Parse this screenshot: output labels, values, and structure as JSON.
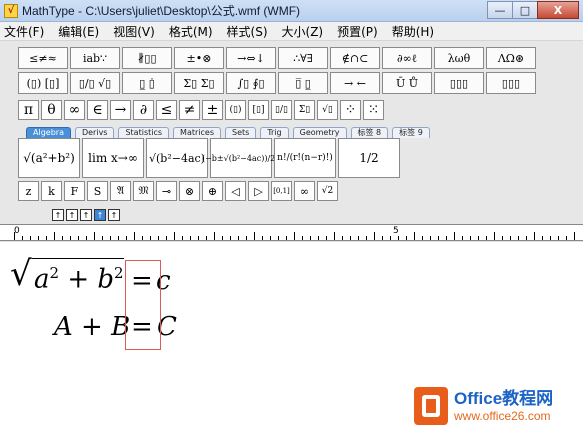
{
  "window": {
    "title": "MathType - C:\\Users\\juliet\\Desktop\\公式.wmf (WMF)",
    "app_icon_letter": "√",
    "buttons": {
      "minimize": "—",
      "maximize": "□",
      "close": "X"
    }
  },
  "menu": [
    "文件(F)",
    "编辑(E)",
    "视图(V)",
    "格式(M)",
    "样式(S)",
    "大小(Z)",
    "预置(P)",
    "帮助(H)"
  ],
  "palette_row1": [
    "≤≠≈",
    "ⅰab∵",
    "∦▯▯",
    "±•⊗",
    "→⇔↓",
    "∴∀∃",
    "∉∩⊂",
    "∂∞ℓ",
    "λωθ",
    "ΛΩ⊛"
  ],
  "palette_row2": [
    "(▯) [▯]",
    "▯/▯ √▯",
    "▯̲ ▯̇",
    "Σ▯ Σ▯",
    "∫▯ ∮▯",
    "▯̅ ▯̲",
    "→ ←",
    "Ū Ů",
    "▯▯▯",
    "▯▯▯"
  ],
  "symbol_row": [
    "π",
    "θ",
    "∞",
    "∈",
    "→",
    "∂",
    "≤",
    "≠",
    "±",
    "(▯)",
    "[▯]",
    "▯/▯",
    "Σ▯",
    "√▯",
    "⁘",
    "⁙"
  ],
  "tabs": [
    "Algebra",
    "Derivs",
    "Statistics",
    "Matrices",
    "Sets",
    "Trig",
    "Geometry",
    "标签 8",
    "标签 9"
  ],
  "active_tab": "Algebra",
  "templates": [
    "√(a²+b²)",
    "lim x→∞",
    "√(b²−4ac)",
    "(−b±√(b²−4ac))/2a",
    "n!/(r!(n−r)!)",
    "1/2"
  ],
  "small_row": [
    "z",
    "k",
    "F",
    "S",
    "𝔄",
    "𝔐",
    "⊸",
    "⊗",
    "⊕",
    "◁",
    "▷",
    "[0,1]",
    "∞",
    "√2"
  ],
  "size_buttons": [
    "↑",
    "↑",
    "↑",
    "↑",
    "↑"
  ],
  "active_size_index": 3,
  "ruler": {
    "mark0": "0",
    "mark5": "5"
  },
  "equation": {
    "line1_base_a": "a",
    "line1_exp_a": "2",
    "line1_plus": "+",
    "line1_base_b": "b",
    "line1_exp_b": "2",
    "line1_eq": "=",
    "line1_rhs": "c",
    "line2_a": "A",
    "line2_plus": "+",
    "line2_b": "B",
    "line2_eq": "=",
    "line2_rhs": "C"
  },
  "watermark": {
    "title": "Office教程网",
    "url": "www.office26.com",
    "brand_color": "#e95d1b"
  }
}
